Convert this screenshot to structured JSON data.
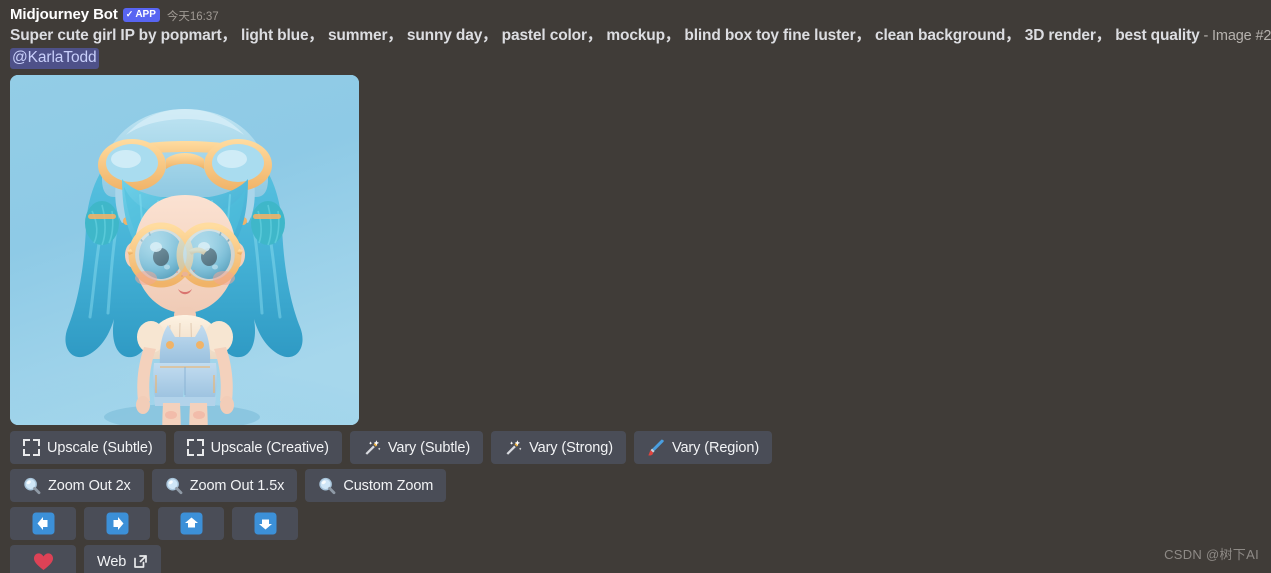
{
  "message": {
    "author": "Midjourney Bot",
    "app_badge": "APP",
    "app_badge_check": "✓",
    "timestamp": "今天16:37",
    "prompt": "Super cute girl IP by popmart， light blue， summer， sunny day， pastel color， mockup， blind box toy fine luster， clean background， 3D render， best quality",
    "prompt_suffix": " - Image #2",
    "mention": "@KarlaTodd"
  },
  "attachment": {
    "alt": "3D rendered chibi girl with blue curly hair, yellow goggles and round glasses, blue overalls and yellow boots on a light blue background",
    "background_color": "#8ecae6",
    "hair_color": "#4db8d8",
    "accent_color": "#f7c480",
    "skin_color": "#f5d7c6",
    "overall_color": "#a8cfe8"
  },
  "buttons": {
    "rows": [
      [
        {
          "label": "Upscale (Subtle)",
          "icon": "upscale-icon",
          "name": "upscale-subtle-button"
        },
        {
          "label": "Upscale (Creative)",
          "icon": "upscale-icon",
          "name": "upscale-creative-button"
        },
        {
          "label": "Vary (Subtle)",
          "icon": "magic-wand-icon",
          "name": "vary-subtle-button"
        },
        {
          "label": "Vary (Strong)",
          "icon": "magic-wand-icon",
          "name": "vary-strong-button"
        },
        {
          "label": "Vary (Region)",
          "icon": "paintbrush-icon",
          "name": "vary-region-button"
        }
      ],
      [
        {
          "label": "Zoom Out 2x",
          "icon": "magnifier-icon",
          "name": "zoom-out-2x-button"
        },
        {
          "label": "Zoom Out 1.5x",
          "icon": "magnifier-icon",
          "name": "zoom-out-1-5x-button"
        },
        {
          "label": "Custom Zoom",
          "icon": "magnifier-icon",
          "name": "custom-zoom-button"
        }
      ],
      [
        {
          "label": "",
          "icon": "arrow-left-icon",
          "name": "pan-left-button"
        },
        {
          "label": "",
          "icon": "arrow-right-icon",
          "name": "pan-right-button"
        },
        {
          "label": "",
          "icon": "arrow-up-icon",
          "name": "pan-up-button"
        },
        {
          "label": "",
          "icon": "arrow-down-icon",
          "name": "pan-down-button"
        }
      ],
      [
        {
          "label": "",
          "icon": "heart-icon",
          "name": "favorite-button"
        },
        {
          "label": "Web",
          "icon": "external-link-icon",
          "name": "web-button"
        }
      ]
    ]
  },
  "watermark": "CSDN @树下AI",
  "colors": {
    "page_background": "#403c38",
    "button_background": "#4a4d57",
    "badge_blurple": "#5865f2",
    "mention_background": "#4e5189",
    "mention_text": "#c9d0fb",
    "emoji_blue": "#3c90d8",
    "heart_red": "#dd4256"
  }
}
